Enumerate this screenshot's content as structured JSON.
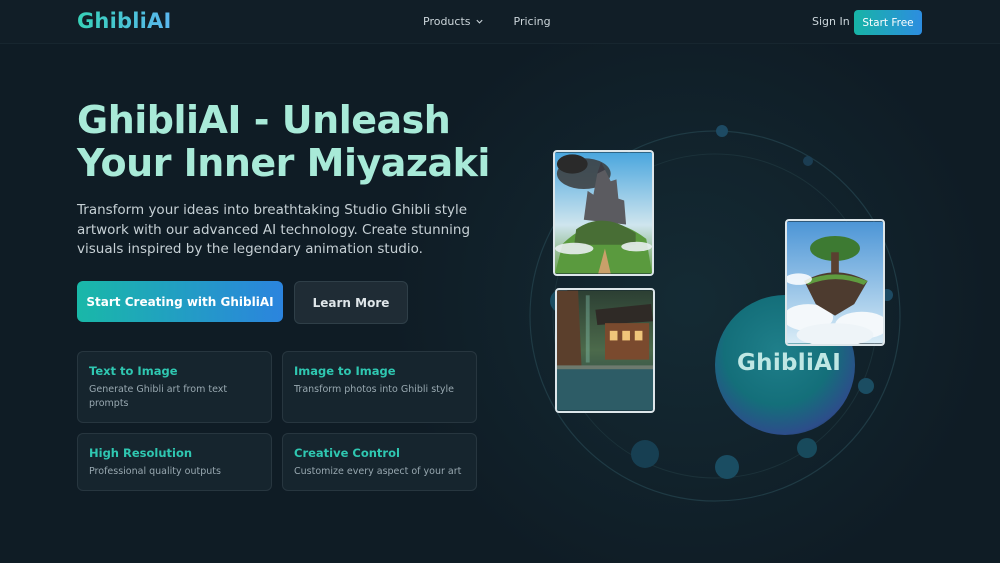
{
  "header": {
    "logo": "GhibliAI",
    "nav": [
      {
        "label": "Products",
        "has_dropdown": true
      },
      {
        "label": "Pricing",
        "has_dropdown": false
      }
    ],
    "sign_in": "Sign In",
    "start_free": "Start Free"
  },
  "hero": {
    "title_line1": "GhibliAI - Unleash",
    "title_line2": "Your Inner Miyazaki",
    "description": "Transform your ideas into breathtaking Studio Ghibli style artwork with our advanced AI technology. Create stunning visuals inspired by the legendary animation studio.",
    "primary_cta": "Start Creating with GhibliAI",
    "secondary_cta": "Learn More"
  },
  "features": [
    {
      "title": "Text to Image",
      "text": "Generate Ghibli art from text prompts"
    },
    {
      "title": "Image to Image",
      "text": "Transform photos into Ghibli style"
    },
    {
      "title": "High Resolution",
      "text": "Professional quality outputs"
    },
    {
      "title": "Creative Control",
      "text": "Customize every aspect of your art"
    }
  ],
  "visual": {
    "brand_word": "GhibliAI"
  },
  "colors": {
    "background": "#0f1c25",
    "accent_teal": "#2fc7b1",
    "accent_blue": "#2b84de",
    "title": "#a8ead8"
  }
}
